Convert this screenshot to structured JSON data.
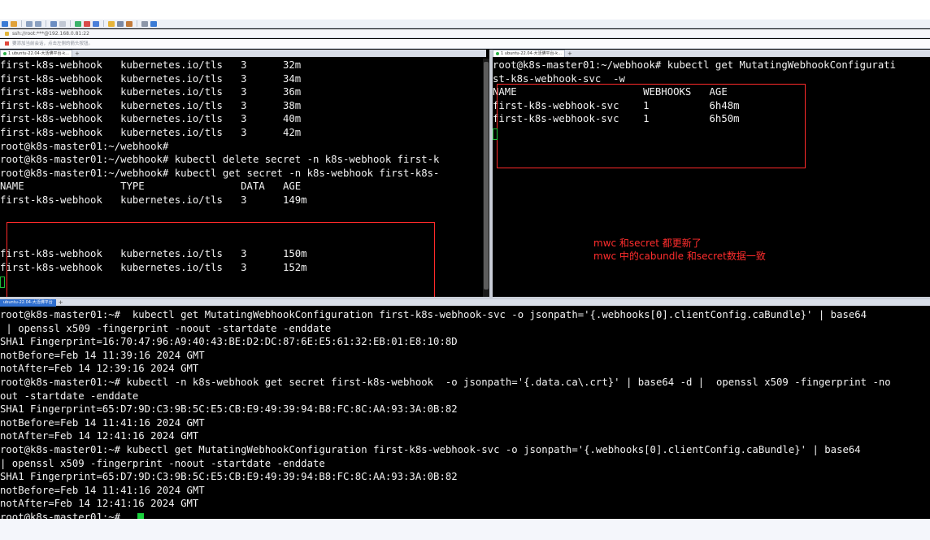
{
  "address_bar": {
    "text": "ssh://root:***@192.168.0.81:22"
  },
  "hint_bar": {
    "text": "要添加当前会话，点击左侧的箭头按钮。"
  },
  "left_pane": {
    "tab_label": "1 ubuntu-22.04-大活佛平台-k...",
    "lines": [
      "first-k8s-webhook   kubernetes.io/tls   3      32m",
      "first-k8s-webhook   kubernetes.io/tls   3      34m",
      "first-k8s-webhook   kubernetes.io/tls   3      36m",
      "first-k8s-webhook   kubernetes.io/tls   3      38m",
      "first-k8s-webhook   kubernetes.io/tls   3      40m",
      "first-k8s-webhook   kubernetes.io/tls   3      42m",
      "root@k8s-master01:~/webhook#",
      "root@k8s-master01:~/webhook# kubectl delete secret -n k8s-webhook first-k",
      "root@k8s-master01:~/webhook# kubectl get secret -n k8s-webhook first-k8s-",
      "NAME                TYPE                DATA   AGE",
      "first-k8s-webhook   kubernetes.io/tls   3      149m",
      "",
      "",
      "",
      "first-k8s-webhook   kubernetes.io/tls   3      150m",
      "first-k8s-webhook   kubernetes.io/tls   3      152m"
    ]
  },
  "right_pane": {
    "tab_label": "1 ubuntu-22.04-大活佛平台-k...",
    "lines": [
      "root@k8s-master01:~/webhook# kubectl get MutatingWebhookConfigurati",
      "st-k8s-webhook-svc  -w",
      "NAME                     WEBHOOKS   AGE",
      "first-k8s-webhook-svc    1          6h48m",
      "first-k8s-webhook-svc    1          6h50m"
    ],
    "annotation_lines": [
      "mwc 和secret 都更新了",
      "mwc 中的cabundle 和secret数据一致"
    ]
  },
  "bottom_pane": {
    "tab_label": "ubuntu-22.04-大活佛平台",
    "lines": [
      "root@k8s-master01:~#  kubectl get MutatingWebhookConfiguration first-k8s-webhook-svc -o jsonpath='{.webhooks[0].clientConfig.caBundle}' | base64",
      " | openssl x509 -fingerprint -noout -startdate -enddate",
      "SHA1 Fingerprint=16:70:47:96:A9:40:43:BE:D2:DC:87:6E:E5:61:32:EB:01:E8:10:8D",
      "notBefore=Feb 14 11:39:16 2024 GMT",
      "notAfter=Feb 14 12:39:16 2024 GMT",
      "root@k8s-master01:~# kubectl -n k8s-webhook get secret first-k8s-webhook  -o jsonpath='{.data.ca\\.crt}' | base64 -d |  openssl x509 -fingerprint -no",
      "out -startdate -enddate",
      "SHA1 Fingerprint=65:D7:9D:C3:9B:5C:E5:CB:E9:49:39:94:B8:FC:8C:AA:93:3A:0B:82",
      "notBefore=Feb 14 11:41:16 2024 GMT",
      "notAfter=Feb 14 12:41:16 2024 GMT",
      "root@k8s-master01:~# kubectl get MutatingWebhookConfiguration first-k8s-webhook-svc -o jsonpath='{.webhooks[0].clientConfig.caBundle}' | base64",
      "| openssl x509 -fingerprint -noout -startdate -enddate",
      "SHA1 Fingerprint=65:D7:9D:C3:9B:5C:E5:CB:E9:49:39:94:B8:FC:8C:AA:93:3A:0B:82",
      "notBefore=Feb 14 11:41:16 2024 GMT",
      "notAfter=Feb 14 12:41:16 2024 GMT",
      "root@k8s-master01:~# "
    ]
  },
  "colors": {
    "terminal_bg": "#000000",
    "terminal_fg": "#f2f2f2",
    "highlight_red": "#ff2a2a",
    "cursor_green": "#19d13c"
  }
}
